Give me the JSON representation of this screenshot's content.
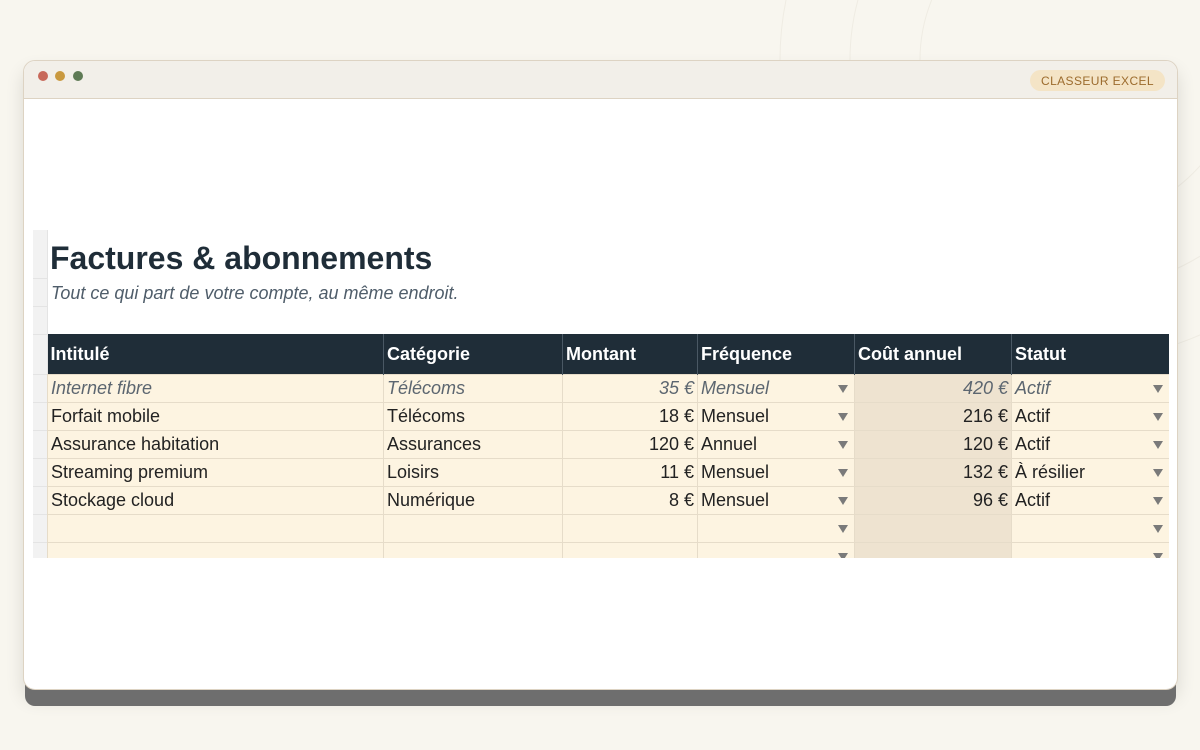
{
  "window": {
    "badge": "CLASSEUR EXCEL"
  },
  "sheet": {
    "title": "Factures & abonnements",
    "subtitle": "Tout ce qui part de votre compte, au même endroit."
  },
  "table": {
    "headers": [
      "Intitulé",
      "Catégorie",
      "Montant",
      "Fréquence",
      "Coût annuel",
      "Statut"
    ],
    "rows": [
      {
        "intitule": "Internet fibre",
        "categorie": "Télécoms",
        "montant": "35 €",
        "frequence": "Mensuel",
        "cout_annuel": "420 €",
        "statut": "Actif"
      },
      {
        "intitule": "Forfait mobile",
        "categorie": "Télécoms",
        "montant": "18 €",
        "frequence": "Mensuel",
        "cout_annuel": "216 €",
        "statut": "Actif"
      },
      {
        "intitule": "Assurance habitation",
        "categorie": "Assurances",
        "montant": "120 €",
        "frequence": "Annuel",
        "cout_annuel": "120 €",
        "statut": "Actif"
      },
      {
        "intitule": "Streaming premium",
        "categorie": "Loisirs",
        "montant": "11 €",
        "frequence": "Mensuel",
        "cout_annuel": "132 €",
        "statut": "À résilier"
      },
      {
        "intitule": "Stockage cloud",
        "categorie": "Numérique",
        "montant": "8 €",
        "frequence": "Mensuel",
        "cout_annuel": "96 €",
        "statut": "Actif"
      },
      {
        "intitule": "",
        "categorie": "",
        "montant": "",
        "frequence": "",
        "cout_annuel": "",
        "statut": ""
      },
      {
        "intitule": "",
        "categorie": "",
        "montant": "",
        "frequence": "",
        "cout_annuel": "",
        "statut": ""
      }
    ]
  },
  "colors": {
    "header_bg": "#1f2d38",
    "input_cell": "#fdf4e1",
    "calc_cell": "#eee3d0",
    "badge_bg": "#f4e4c6",
    "badge_text": "#9c6b2d"
  },
  "icons": {
    "dropdown": "chevron-down-icon"
  }
}
